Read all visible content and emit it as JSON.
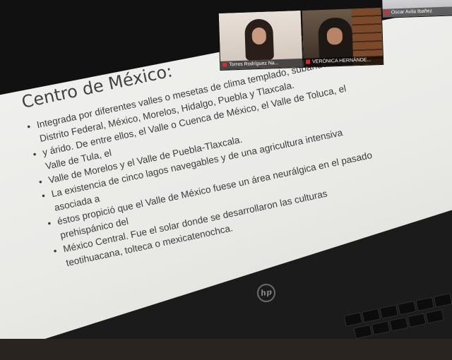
{
  "slide": {
    "title": "Centro de México:",
    "bullets": [
      "Integrada por diferentes valles o mesetas de clima templado, subárido:",
      "Distrito Federal, México, Morelos, Hidalgo, Puebla y Tlaxcala.",
      "y árido. De entre ellos, el Valle o Cuenca de México, el Valle de Toluca, el",
      "Valle de Tula, el",
      "Valle de Morelos y el Valle de Puebla-Tlaxcala.",
      "La existencia de cinco lagos navegables y de una agricultura intensiva",
      "asociada a",
      "éstos propició que el Valle de México fuese un área neurálgica en el pasado",
      "prehispánico del",
      "México Central. Fue el solar donde se desarrollaron las culturas",
      "teotihuacana, tolteca o mexicatenochca."
    ]
  },
  "participants": [
    {
      "name": "Torres Rodríguez Na...",
      "muted": true
    },
    {
      "name": "VERÓNICA HERNÁNDE...",
      "muted": true
    },
    {
      "name": "Oscar Avila Ibañez",
      "muted": true
    }
  ],
  "laptop": {
    "brand_logo": "hp"
  },
  "colors": {
    "slide_bg": "#eeeeeb",
    "slide_text": "#3b3b3b",
    "mic_muted": "#d03030"
  }
}
